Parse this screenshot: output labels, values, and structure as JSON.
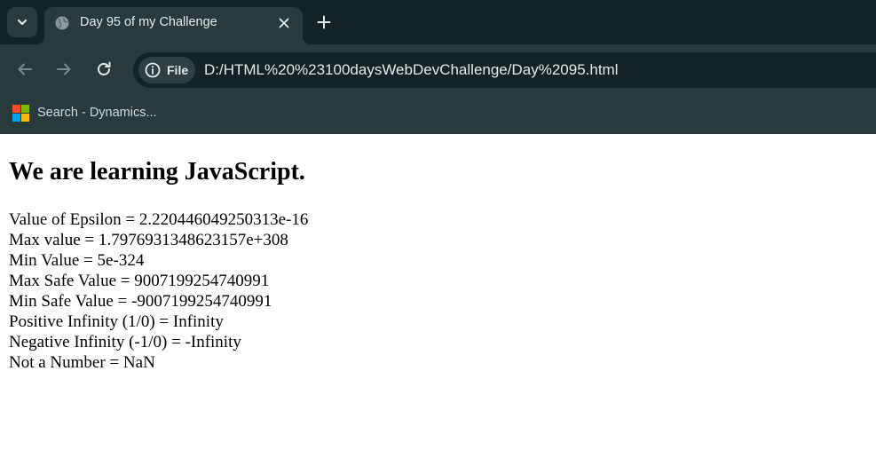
{
  "browser": {
    "tab": {
      "title": "Day 95 of my Challenge"
    },
    "address_bar": {
      "chip_label": "File",
      "url": "D:/HTML%20%23100daysWebDevChallenge/Day%2095.html"
    },
    "bookmarks": [
      {
        "label": "Search - Dynamics..."
      }
    ],
    "colors": {
      "tabstrip": "#122225",
      "toolbar": "#293a3d",
      "text": "#e3e9ea"
    },
    "icons": [
      "chevron-down-icon",
      "globe-icon",
      "close-icon",
      "plus-icon",
      "back-arrow-icon",
      "forward-arrow-icon",
      "reload-icon",
      "info-icon",
      "microsoft-logo-icon"
    ]
  },
  "page": {
    "heading": "We are learning JavaScript.",
    "lines": [
      "Value of Epsilon = 2.220446049250313e-16",
      "Max value = 1.7976931348623157e+308",
      "Min Value = 5e-324",
      "Max Safe Value = 9007199254740991",
      "Min Safe Value = -9007199254740991",
      "Positive Infinity (1/0) = Infinity",
      "Negative Infinity (-1/0) = -Infinity",
      "Not a Number = NaN"
    ]
  }
}
